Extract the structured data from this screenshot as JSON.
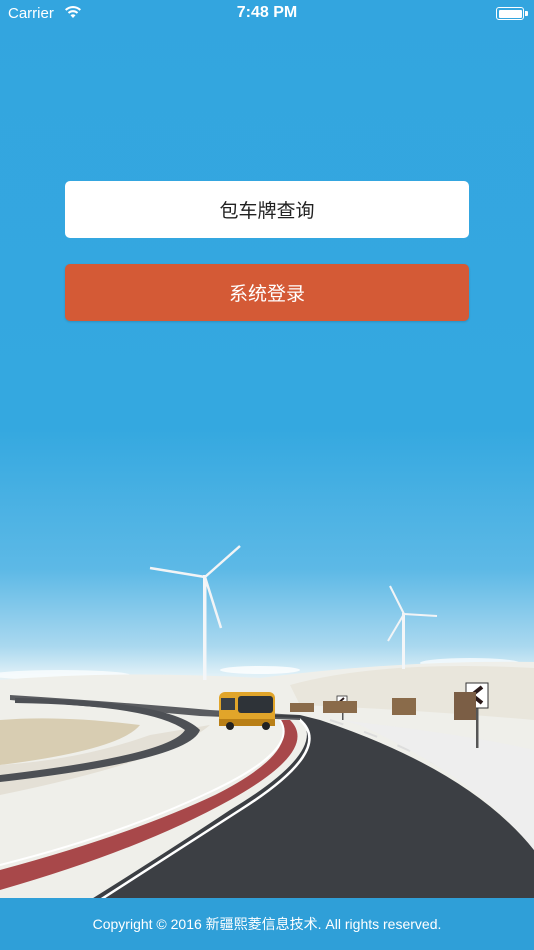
{
  "status_bar": {
    "carrier": "Carrier",
    "time": "7:48 PM",
    "battery_level": 1.0
  },
  "buttons": {
    "query_label": "包车牌查询",
    "login_label": "系统登录"
  },
  "footer": {
    "copyright": "Copyright © 2016 新疆熙菱信息技术. All rights reserved."
  },
  "colors": {
    "background": "#33a5df",
    "login_button": "#d45a36",
    "footer": "#2f9fd8"
  }
}
